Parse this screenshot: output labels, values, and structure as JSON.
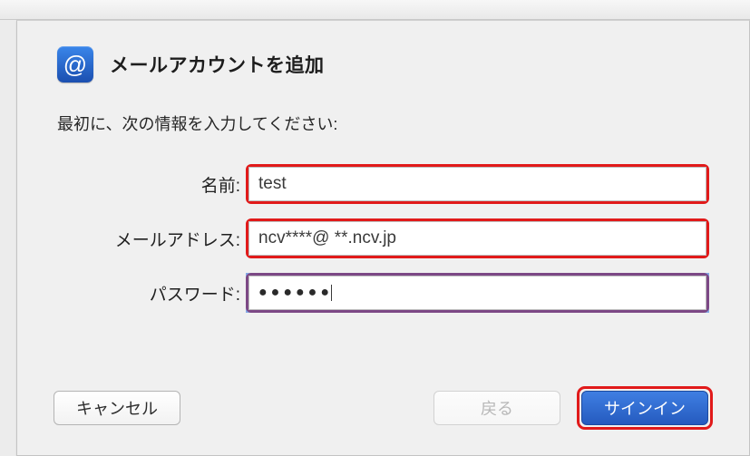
{
  "header": {
    "icon_glyph": "@",
    "title": "メールアカウントを追加"
  },
  "subtitle": "最初に、次の情報を入力してください:",
  "form": {
    "name": {
      "label": "名前:",
      "value": "test"
    },
    "email": {
      "label": "メールアドレス:",
      "value": "ncv****@ **.ncv.jp"
    },
    "password": {
      "label": "パスワード:",
      "value_masked": "●●●●●●"
    }
  },
  "buttons": {
    "cancel": "キャンセル",
    "back": "戻る",
    "signin": "サインイン"
  }
}
